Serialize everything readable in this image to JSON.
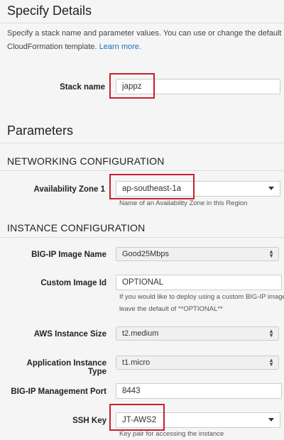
{
  "header": {
    "title": "Specify Details",
    "description_line1": "Specify a stack name and parameter values. You can use or change the default pa",
    "description_line2_prefix": "CloudFormation template.",
    "learn_more": "Learn more."
  },
  "stack": {
    "label": "Stack name",
    "value": "jappz"
  },
  "parameters_title": "Parameters",
  "networking": {
    "title": "NETWORKING CONFIGURATION",
    "az_label": "Availability Zone 1",
    "az_value": "ap-southeast-1a",
    "az_help": "Name of an Availability Zone in this Region"
  },
  "instance": {
    "title": "INSTANCE CONFIGURATION",
    "image_label": "BIG-IP Image Name",
    "image_value": "Good25Mbps",
    "custom_label": "Custom Image Id",
    "custom_value": "OPTIONAL",
    "custom_help_1": "If you would like to deploy using a custom BIG-IP image,",
    "custom_help_2": "leave the default of **OPTIONAL**",
    "size_label": "AWS Instance Size",
    "size_value": "t2.medium",
    "app_label": "Application Instance Type",
    "app_value": "t1.micro",
    "port_label": "BIG-IP Management Port",
    "port_value": "8443",
    "ssh_label": "SSH Key",
    "ssh_value": "JT-AWS2",
    "ssh_help": "Key pair for accessing the instance"
  },
  "colors": {
    "highlight": "#cc1f2b",
    "link": "#1a6fb8"
  }
}
